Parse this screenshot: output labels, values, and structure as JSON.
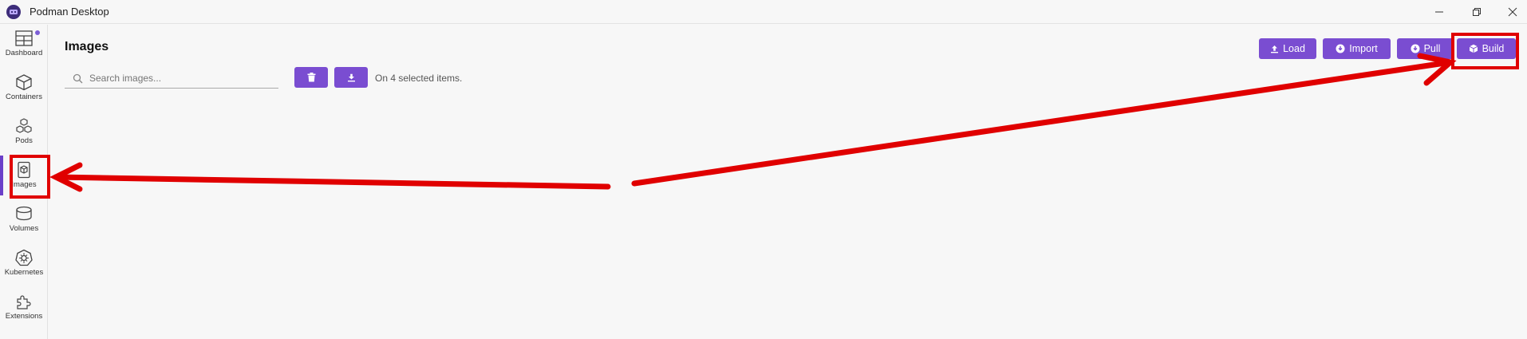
{
  "window": {
    "title": "Podman Desktop",
    "controls": [
      "minimize",
      "restore",
      "close"
    ]
  },
  "sidebar": {
    "items": [
      {
        "label": "Dashboard",
        "icon": "dashboard-icon"
      },
      {
        "label": "Containers",
        "icon": "containers-icon"
      },
      {
        "label": "Pods",
        "icon": "pods-icon"
      },
      {
        "label": "Images",
        "icon": "images-icon",
        "active": true
      },
      {
        "label": "Volumes",
        "icon": "volumes-icon"
      },
      {
        "label": "Kubernetes",
        "icon": "kubernetes-icon"
      },
      {
        "label": "Extensions",
        "icon": "extensions-icon"
      }
    ]
  },
  "header": {
    "title": "Images",
    "buttons": [
      {
        "label": "Load",
        "icon": "upload-icon"
      },
      {
        "label": "Import",
        "icon": "import-icon"
      },
      {
        "label": "Pull",
        "icon": "pull-icon"
      },
      {
        "label": "Build",
        "icon": "cube-icon"
      }
    ]
  },
  "toolbar": {
    "search_placeholder": "Search images...",
    "selection_text": "On 4 selected items."
  },
  "colors": {
    "accent": "#7a4dd1",
    "annotation": "#e00000",
    "background": "#f7f7f7"
  }
}
